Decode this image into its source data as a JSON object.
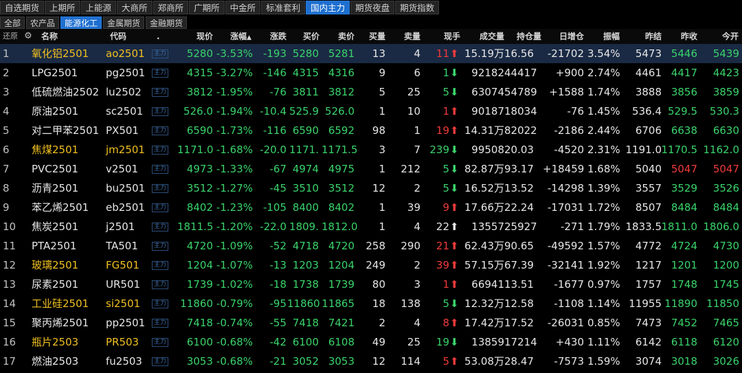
{
  "tabs_main": [
    "自选期货",
    "上期所",
    "上能源",
    "大商所",
    "郑商所",
    "广期所",
    "中金所",
    "标准套利",
    "国内主力",
    "期货夜盘",
    "期货指数"
  ],
  "tabs_main_active": 8,
  "tabs_sub": [
    "全部",
    "农产品",
    "能源化工",
    "金属期货",
    "金融期货"
  ],
  "tabs_sub_active": 2,
  "header": {
    "restore": "还原",
    "settings_icon": "gear-icon",
    "name": "名称",
    "code": "代码",
    "dot": ".",
    "price": "现价",
    "pct": "涨幅",
    "chg": "涨跌",
    "bid": "买价",
    "ask": "卖价",
    "bidvol": "买量",
    "askvol": "卖量",
    "tick": "现手",
    "vol": "成交量",
    "oi": "持仓量",
    "oichg": "日增仓",
    "amp": "振幅",
    "prevsettle": "昨结",
    "prevclose": "昨收",
    "open": "今开"
  },
  "colors": {
    "red": "#f03a3a",
    "green": "#3ad36b",
    "yellow": "#f0c020",
    "selected": "#1a2a44",
    "tab_active": "#1e6fd0"
  },
  "rows": [
    {
      "no": "1",
      "name": "氧化铝2501",
      "code": "ao2501",
      "tag": "主力",
      "price": "5280",
      "pct": "-3.53%",
      "chg": "-193",
      "bid": "5280",
      "ask": "5281",
      "bidvol": "13",
      "askvol": "4",
      "tick": "11",
      "dir": "up",
      "vol": "15.19万",
      "oi": "16.56",
      "oichg": "-21702",
      "amp": "3.54%",
      "ps": "5473",
      "pc": "5446",
      "op": "5439",
      "hl": true,
      "sel": true,
      "pc_c": "green",
      "op_c": "green"
    },
    {
      "no": "2",
      "name": "LPG2501",
      "code": "pg2501",
      "tag": "主力",
      "price": "4315",
      "pct": "-3.27%",
      "chg": "-146",
      "bid": "4315",
      "ask": "4316",
      "bidvol": "9",
      "askvol": "6",
      "tick": "1",
      "dir": "down",
      "vol": "92182",
      "oi": "44417",
      "oichg": "+900",
      "amp": "2.74%",
      "ps": "4461",
      "pc": "4417",
      "op": "4423",
      "hl": false,
      "sel": false,
      "pc_c": "green",
      "op_c": "green"
    },
    {
      "no": "3",
      "name": "低硫燃油2502",
      "code": "lu2502",
      "tag": "主力",
      "price": "3812",
      "pct": "-1.95%",
      "chg": "-76",
      "bid": "3811",
      "ask": "3812",
      "bidvol": "5",
      "askvol": "25",
      "tick": "5",
      "dir": "down",
      "vol": "63074",
      "oi": "54789",
      "oichg": "+1588",
      "amp": "1.74%",
      "ps": "3888",
      "pc": "3856",
      "op": "3859",
      "hl": false,
      "sel": false,
      "pc_c": "green",
      "op_c": "green"
    },
    {
      "no": "4",
      "name": "原油2501",
      "code": "sc2501",
      "tag": "主力",
      "price": "526.0",
      "pct": "-1.94%",
      "chg": "-10.4",
      "bid": "525.9",
      "ask": "526.0",
      "bidvol": "1",
      "askvol": "10",
      "tick": "1",
      "dir": "up",
      "vol": "90187",
      "oi": "18034",
      "oichg": "-76",
      "amp": "1.45%",
      "ps": "536.4",
      "pc": "529.5",
      "op": "530.3",
      "hl": false,
      "sel": false,
      "pc_c": "green",
      "op_c": "green"
    },
    {
      "no": "5",
      "name": "对二甲苯2501",
      "code": "PX501",
      "tag": "主力",
      "price": "6590",
      "pct": "-1.73%",
      "chg": "-116",
      "bid": "6590",
      "ask": "6592",
      "bidvol": "98",
      "askvol": "1",
      "tick": "19",
      "dir": "up",
      "vol": "14.31万",
      "oi": "82022",
      "oichg": "-2186",
      "amp": "2.44%",
      "ps": "6706",
      "pc": "6638",
      "op": "6630",
      "hl": false,
      "sel": false,
      "pc_c": "green",
      "op_c": "green"
    },
    {
      "no": "6",
      "name": "焦煤2501",
      "code": "jm2501",
      "tag": "主力",
      "price": "1171.0",
      "pct": "-1.68%",
      "chg": "-20.0",
      "bid": "1171.",
      "ask": "1171.5",
      "bidvol": "3",
      "askvol": "7",
      "tick": "239",
      "dir": "down",
      "vol": "99508",
      "oi": "20.03",
      "oichg": "-4520",
      "amp": "2.31%",
      "ps": "1191.0",
      "pc": "1170.5",
      "op": "1162.0",
      "hl": true,
      "sel": false,
      "pc_c": "green",
      "op_c": "green"
    },
    {
      "no": "7",
      "name": "PVC2501",
      "code": "v2501",
      "tag": "主力",
      "price": "4973",
      "pct": "-1.33%",
      "chg": "-67",
      "bid": "4974",
      "ask": "4975",
      "bidvol": "1",
      "askvol": "212",
      "tick": "5",
      "dir": "down",
      "vol": "82.87万",
      "oi": "93.17",
      "oichg": "+18459",
      "amp": "1.68%",
      "ps": "5040",
      "pc": "5047",
      "op": "5047",
      "hl": false,
      "sel": false,
      "pc_c": "red",
      "op_c": "red"
    },
    {
      "no": "8",
      "name": "沥青2501",
      "code": "bu2501",
      "tag": "主力",
      "price": "3512",
      "pct": "-1.27%",
      "chg": "-45",
      "bid": "3510",
      "ask": "3512",
      "bidvol": "12",
      "askvol": "2",
      "tick": "5",
      "dir": "down",
      "vol": "16.52万",
      "oi": "13.52",
      "oichg": "-14298",
      "amp": "1.39%",
      "ps": "3557",
      "pc": "3529",
      "op": "3526",
      "hl": false,
      "sel": false,
      "pc_c": "green",
      "op_c": "green"
    },
    {
      "no": "9",
      "name": "苯乙烯2501",
      "code": "eb2501",
      "tag": "主力",
      "price": "8402",
      "pct": "-1.23%",
      "chg": "-105",
      "bid": "8400",
      "ask": "8402",
      "bidvol": "1",
      "askvol": "39",
      "tick": "9",
      "dir": "up",
      "vol": "17.66万",
      "oi": "22.24",
      "oichg": "-17031",
      "amp": "1.72%",
      "ps": "8507",
      "pc": "8484",
      "op": "8484",
      "hl": false,
      "sel": false,
      "pc_c": "green",
      "op_c": "green"
    },
    {
      "no": "10",
      "name": "焦炭2501",
      "code": "j2501",
      "tag": "主力",
      "price": "1811.5",
      "pct": "-1.20%",
      "chg": "-22.0",
      "bid": "1809.",
      "ask": "1812.0",
      "bidvol": "1",
      "askvol": "4",
      "tick": "22",
      "dir": "flat",
      "vol": "13557",
      "oi": "25927",
      "oichg": "-271",
      "amp": "1.79%",
      "ps": "1833.5",
      "pc": "1811.0",
      "op": "1806.0",
      "hl": false,
      "sel": false,
      "pc_c": "green",
      "op_c": "green"
    },
    {
      "no": "11",
      "name": "PTA2501",
      "code": "TA501",
      "tag": "主力",
      "price": "4720",
      "pct": "-1.09%",
      "chg": "-52",
      "bid": "4718",
      "ask": "4720",
      "bidvol": "258",
      "askvol": "290",
      "tick": "21",
      "dir": "up",
      "vol": "62.43万",
      "oi": "90.65",
      "oichg": "-49592",
      "amp": "1.57%",
      "ps": "4772",
      "pc": "4724",
      "op": "4730",
      "hl": false,
      "sel": false,
      "pc_c": "green",
      "op_c": "green"
    },
    {
      "no": "12",
      "name": "玻璃2501",
      "code": "FG501",
      "tag": "主力",
      "price": "1204",
      "pct": "-1.07%",
      "chg": "-13",
      "bid": "1203",
      "ask": "1204",
      "bidvol": "249",
      "askvol": "2",
      "tick": "39",
      "dir": "up",
      "vol": "57.15万",
      "oi": "67.39",
      "oichg": "-32141",
      "amp": "1.92%",
      "ps": "1217",
      "pc": "1201",
      "op": "1200",
      "hl": true,
      "sel": false,
      "pc_c": "green",
      "op_c": "green"
    },
    {
      "no": "13",
      "name": "尿素2501",
      "code": "UR501",
      "tag": "主力",
      "price": "1739",
      "pct": "-1.02%",
      "chg": "-18",
      "bid": "1738",
      "ask": "1739",
      "bidvol": "80",
      "askvol": "3",
      "tick": "1",
      "dir": "up",
      "vol": "66941",
      "oi": "13.51",
      "oichg": "-1677",
      "amp": "0.97%",
      "ps": "1757",
      "pc": "1748",
      "op": "1745",
      "hl": false,
      "sel": false,
      "pc_c": "green",
      "op_c": "green"
    },
    {
      "no": "14",
      "name": "工业硅2501",
      "code": "si2501",
      "tag": "主力",
      "price": "11860",
      "pct": "-0.79%",
      "chg": "-95",
      "bid": "11860",
      "ask": "11865",
      "bidvol": "18",
      "askvol": "138",
      "tick": "5",
      "dir": "down",
      "vol": "12.32万",
      "oi": "12.58",
      "oichg": "-1108",
      "amp": "1.14%",
      "ps": "11955",
      "pc": "11890",
      "op": "11850",
      "hl": true,
      "sel": false,
      "pc_c": "green",
      "op_c": "green"
    },
    {
      "no": "15",
      "name": "聚丙烯2501",
      "code": "pp2501",
      "tag": "主力",
      "price": "7418",
      "pct": "-0.74%",
      "chg": "-55",
      "bid": "7418",
      "ask": "7421",
      "bidvol": "2",
      "askvol": "4",
      "tick": "8",
      "dir": "up",
      "vol": "17.42万",
      "oi": "17.52",
      "oichg": "-26031",
      "amp": "0.85%",
      "ps": "7473",
      "pc": "7452",
      "op": "7465",
      "hl": false,
      "sel": false,
      "pc_c": "green",
      "op_c": "green"
    },
    {
      "no": "16",
      "name": "瓶片2503",
      "code": "PR503",
      "tag": "主力",
      "price": "6100",
      "pct": "-0.68%",
      "chg": "-42",
      "bid": "6100",
      "ask": "6108",
      "bidvol": "49",
      "askvol": "25",
      "tick": "19",
      "dir": "down",
      "vol": "13859",
      "oi": "17214",
      "oichg": "+430",
      "amp": "1.11%",
      "ps": "6142",
      "pc": "6118",
      "op": "6120",
      "hl": true,
      "sel": false,
      "pc_c": "green",
      "op_c": "green"
    },
    {
      "no": "17",
      "name": "燃油2503",
      "code": "fu2503",
      "tag": "主力",
      "price": "3053",
      "pct": "-0.68%",
      "chg": "-21",
      "bid": "3052",
      "ask": "3053",
      "bidvol": "12",
      "askvol": "114",
      "tick": "5",
      "dir": "up",
      "vol": "53.08万",
      "oi": "28.47",
      "oichg": "-7573",
      "amp": "1.59%",
      "ps": "3074",
      "pc": "3018",
      "op": "3026",
      "hl": false,
      "sel": false,
      "pc_c": "green",
      "op_c": "green"
    }
  ]
}
